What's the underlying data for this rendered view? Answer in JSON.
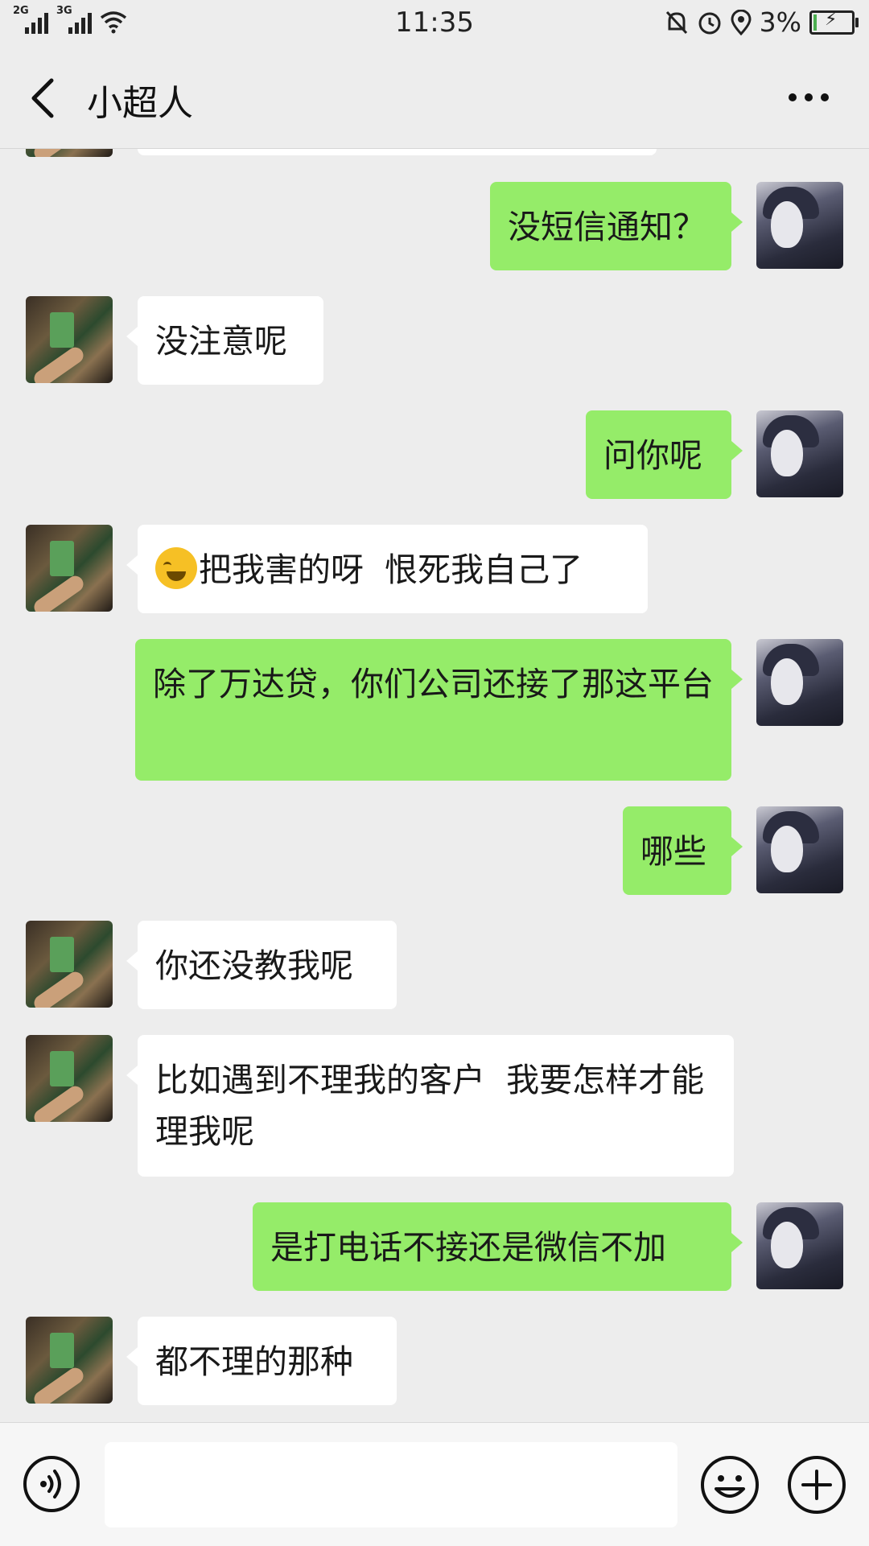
{
  "status_bar": {
    "time": "11:35",
    "signal1_tag": "2G",
    "signal2_tag": "3G",
    "battery": "3%",
    "icons": [
      "mute-icon",
      "alarm-icon",
      "location-icon",
      "wifi-icon"
    ]
  },
  "header": {
    "title": "小超人",
    "back_icon": "chevron-left-icon",
    "more_icon": "more-dots-icon"
  },
  "messages": [
    {
      "from": "self",
      "text": "没短信通知？"
    },
    {
      "from": "peer",
      "text": "没注意呢"
    },
    {
      "from": "self",
      "text": "问你呢"
    },
    {
      "from": "peer",
      "emoji": "crying-laughing-emoji",
      "text": "把我害的呀  恨死我自己了"
    },
    {
      "from": "self",
      "text": "除了万达贷，你们公司还接了那这平台"
    },
    {
      "from": "self",
      "text": "哪些"
    },
    {
      "from": "peer",
      "text": "你还没教我呢"
    },
    {
      "from": "peer",
      "text": "比如遇到不理我的客户  我要怎样才能理我呢"
    },
    {
      "from": "self",
      "text": "是打电话不接还是微信不加"
    },
    {
      "from": "peer",
      "text": "都不理的那种"
    }
  ],
  "input_bar": {
    "value": "",
    "voice_icon": "voice-icon",
    "emoji_icon": "emoji-icon",
    "plus_icon": "plus-icon"
  },
  "colors": {
    "background": "#ededed",
    "self_bubble": "#95ec69",
    "peer_bubble": "#ffffff"
  }
}
